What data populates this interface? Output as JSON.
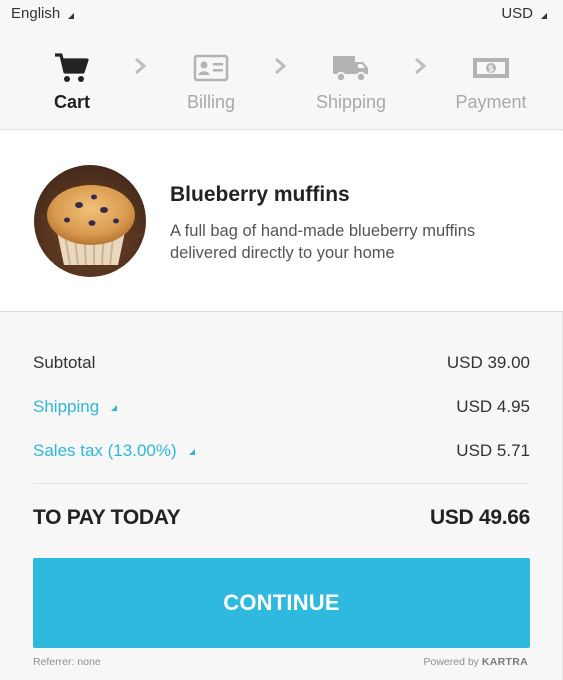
{
  "topbar": {
    "language": "English",
    "currency": "USD"
  },
  "steps": [
    {
      "label": "Cart",
      "icon": "cart-icon",
      "active": true
    },
    {
      "label": "Billing",
      "icon": "id-card-icon",
      "active": false
    },
    {
      "label": "Shipping",
      "icon": "truck-icon",
      "active": false
    },
    {
      "label": "Payment",
      "icon": "banknote-icon",
      "active": false
    }
  ],
  "product": {
    "title": "Blueberry muffins",
    "description": "A full bag of hand-made blueberry muffins delivered directly to your home",
    "image": "blueberry-muffin-photo"
  },
  "summary": {
    "subtotal_label": "Subtotal",
    "subtotal_value": "USD 39.00",
    "shipping_label": "Shipping",
    "shipping_value": "USD 4.95",
    "tax_label": "Sales tax (13.00%)",
    "tax_value": "USD 5.71",
    "total_label": "TO PAY TODAY",
    "total_value": "USD 49.66"
  },
  "cta": {
    "label": "CONTINUE"
  },
  "footer": {
    "referrer": "Referrer: none",
    "powered_by": "Powered by",
    "brand": "KARTRA"
  },
  "colors": {
    "accent": "#30b9df",
    "link": "#30b7d8",
    "text": "#222222",
    "muted": "#a9a9a9"
  }
}
